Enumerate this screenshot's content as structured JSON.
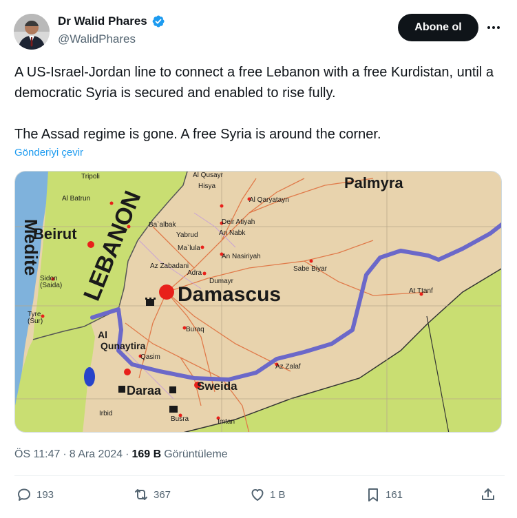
{
  "author": {
    "display_name": "Dr Walid Phares",
    "handle": "@WalidPhares"
  },
  "follow_label": "Abone ol",
  "tweet": {
    "line1": "A US-Israel-Jordan line to connect a free Lebanon with a free Kurdistan, until a democratic Syria is secured and enabled to rise fully.",
    "line2": "The Assad regime is gone. A free Syria is around the corner.",
    "translate": "Gönderiyi çevir"
  },
  "map": {
    "labels": {
      "palmyra": "Palmyra",
      "beirut": "Beirut",
      "lebanon": "LEBANON",
      "damascus": "Damascus",
      "daraa": "Daraa",
      "sweida": "Sweida",
      "tripoli": "Tripoli",
      "batrun": "Al Batrun",
      "sidon": "Sidon",
      "saida": "(Saida)",
      "tyre": "Tyre",
      "sur": "(Sur)",
      "mediterranean": "Medite",
      "qusayr": "Al Qusayr",
      "hisya": "Hisya",
      "qaryatayn": "Al Qaryatayn",
      "deir_atiyah": "Deir Atiyah",
      "nabk": "An Nabk",
      "yabrud": "Yabrud",
      "baalbek": "Ba`albak",
      "maalula": "Ma`lula",
      "nasiriyah": "An Nasiriyah",
      "zabadani": "Az Zabadani",
      "adra": "Adra",
      "dumayr": "Dumayr",
      "sabe_biyar": "Sabe Biyar",
      "at_tanf": "At Ttanf",
      "buraq": "Buraq",
      "quneitra_al": "Al",
      "quneitra": "Qunaytira",
      "qasim": "Qasim",
      "az_zalaf": "Az Zalaf",
      "irbid": "Irbid",
      "busra": "Busra",
      "imtan": "Imtan"
    },
    "colors": {
      "lebanon_land": "#c9de72",
      "syria_land": "#e8d3ad",
      "jordan_land": "#c9de72",
      "sea": "#7fb2dc",
      "route_line": "#6b68c9",
      "roads": "#e07a4a",
      "city_dot": "#e8201a"
    }
  },
  "meta": {
    "time": "ÖS 11:47",
    "date": "8 Ara 2024",
    "views_count": "169 B",
    "views_label": "Görüntüleme"
  },
  "actions": {
    "replies": "193",
    "reposts": "367",
    "likes": "1 B",
    "bookmarks": "161"
  },
  "icons": [
    "verified-badge-icon",
    "more-icon",
    "reply-icon",
    "repost-icon",
    "like-icon",
    "bookmark-icon",
    "share-icon"
  ]
}
